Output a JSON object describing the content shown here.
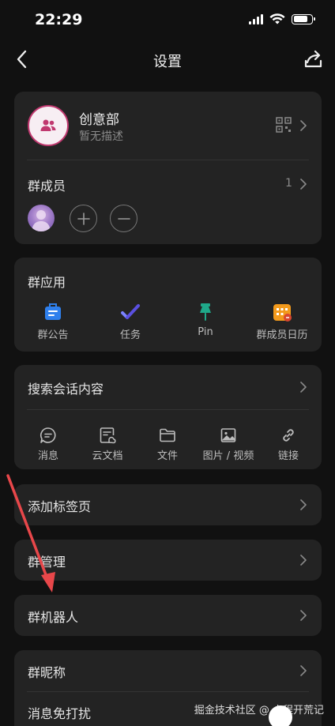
{
  "status_bar": {
    "time": "22:29"
  },
  "nav": {
    "title": "设置"
  },
  "group": {
    "name": "创意部",
    "description": "暂无描述"
  },
  "members": {
    "label": "群成员",
    "count": "1"
  },
  "apps": {
    "title": "群应用",
    "items": [
      {
        "label": "群公告",
        "icon": "announcement-icon",
        "color": "#2f80ed"
      },
      {
        "label": "任务",
        "icon": "task-check-icon",
        "color": "#6a6cf0"
      },
      {
        "label": "Pin",
        "icon": "pin-icon",
        "color": "#1fa98a"
      },
      {
        "label": "群成员日历",
        "icon": "calendar-icon",
        "color": "#f39a1c"
      }
    ]
  },
  "search": {
    "title": "搜索会话内容",
    "filters": [
      {
        "label": "消息",
        "icon": "message-icon"
      },
      {
        "label": "云文档",
        "icon": "cloud-doc-icon"
      },
      {
        "label": "文件",
        "icon": "folder-icon"
      },
      {
        "label": "图片 / 视频",
        "icon": "image-icon"
      },
      {
        "label": "链接",
        "icon": "link-icon"
      }
    ]
  },
  "rows": {
    "add_tab": "添加标签页",
    "manage": "群管理",
    "bot": "群机器人",
    "nickname": "群昵称",
    "mute": "消息免打扰"
  },
  "watermark": "掘金技术社区 @ 小程开荒记",
  "colors": {
    "background": "#111111",
    "card": "#232323",
    "accent": "#c0386f",
    "arrow": "#e8474a"
  }
}
